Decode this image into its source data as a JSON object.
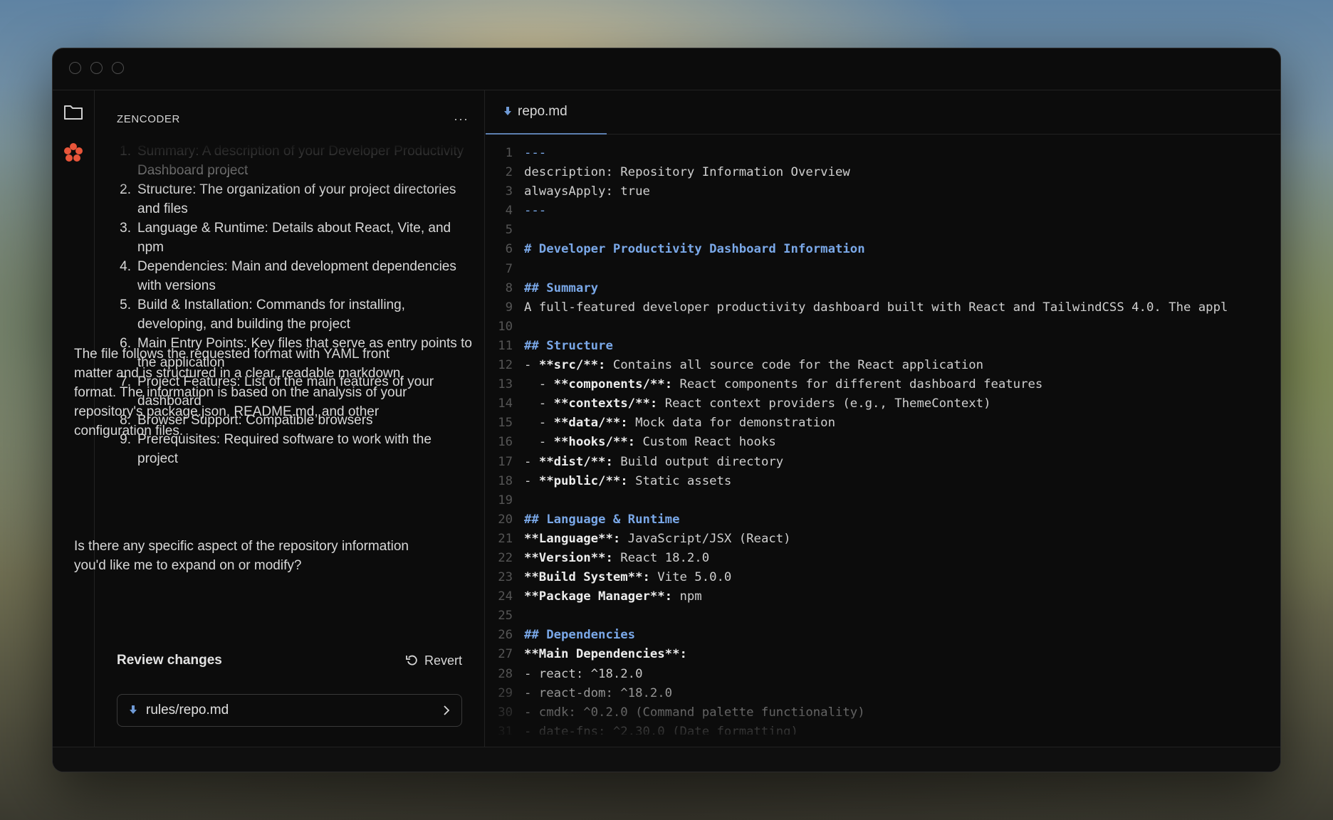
{
  "window": {
    "traffic_lights": [
      "close",
      "minimize",
      "zoom"
    ]
  },
  "activity_bar": {
    "icons": [
      "folder-icon",
      "zencoder-logo"
    ]
  },
  "chat": {
    "brand": "ZENCODER",
    "more_label": "···",
    "list": [
      {
        "num": "1.",
        "text": "Summary: A description of your Developer Productivity Dashboard project"
      },
      {
        "num": "2.",
        "text": "Structure: The organization of your project directories and files"
      },
      {
        "num": "3.",
        "text": "Language & Runtime: Details about React, Vite, and npm"
      },
      {
        "num": "4.",
        "text": "Dependencies: Main and development dependencies with versions"
      },
      {
        "num": "5.",
        "text": "Build & Installation: Commands for installing, developing, and building the project"
      },
      {
        "num": "6.",
        "text": "Main Entry Points: Key files that serve as entry points to the application"
      },
      {
        "num": "7.",
        "text": "Project Features: List of the main features of your dashboard"
      },
      {
        "num": "8.",
        "text": "Browser Support: Compatible browsers"
      },
      {
        "num": "9.",
        "text": "Prerequisites: Required software to work with the project"
      }
    ],
    "paragraph": "The file follows the requested format with YAML front matter and is structured in a clear, readable markdown format. The information is based on the analysis of your repository's package.json, README.md, and other configuration files.",
    "question": "Is there any specific aspect of the repository information you'd like me to expand on or modify?",
    "review_title": "Review changes",
    "revert_label": "Revert",
    "changed_file": "rules/repo.md"
  },
  "editor": {
    "tab_label": "repo.md",
    "lines": [
      [
        {
          "t": "---",
          "c": "sep"
        }
      ],
      [
        {
          "t": "description: Repository Information Overview",
          "c": ""
        }
      ],
      [
        {
          "t": "alwaysApply: true",
          "c": ""
        }
      ],
      [
        {
          "t": "---",
          "c": "sep"
        }
      ],
      [],
      [
        {
          "t": "# Developer Productivity Dashboard Information",
          "c": "hl"
        }
      ],
      [],
      [
        {
          "t": "## Summary",
          "c": "hl"
        }
      ],
      [
        {
          "t": "A full-featured developer productivity dashboard built with React and TailwindCSS 4.0. The appl",
          "c": ""
        }
      ],
      [],
      [
        {
          "t": "## Structure",
          "c": "hl"
        }
      ],
      [
        {
          "t": "- ",
          "c": ""
        },
        {
          "t": "**src/**:",
          "c": "b"
        },
        {
          "t": " Contains all source code for the React application",
          "c": ""
        }
      ],
      [
        {
          "t": "  - ",
          "c": ""
        },
        {
          "t": "**components/**:",
          "c": "b"
        },
        {
          "t": " React components for different dashboard features",
          "c": ""
        }
      ],
      [
        {
          "t": "  - ",
          "c": ""
        },
        {
          "t": "**contexts/**:",
          "c": "b"
        },
        {
          "t": " React context providers (e.g., ThemeContext)",
          "c": ""
        }
      ],
      [
        {
          "t": "  - ",
          "c": ""
        },
        {
          "t": "**data/**:",
          "c": "b"
        },
        {
          "t": " Mock data for demonstration",
          "c": ""
        }
      ],
      [
        {
          "t": "  - ",
          "c": ""
        },
        {
          "t": "**hooks/**:",
          "c": "b"
        },
        {
          "t": " Custom React hooks",
          "c": ""
        }
      ],
      [
        {
          "t": "- ",
          "c": ""
        },
        {
          "t": "**dist/**:",
          "c": "b"
        },
        {
          "t": " Build output directory",
          "c": ""
        }
      ],
      [
        {
          "t": "- ",
          "c": ""
        },
        {
          "t": "**public/**:",
          "c": "b"
        },
        {
          "t": " Static assets",
          "c": ""
        }
      ],
      [],
      [
        {
          "t": "## Language & Runtime",
          "c": "hl"
        }
      ],
      [
        {
          "t": "**Language**:",
          "c": "b"
        },
        {
          "t": " JavaScript/JSX (React)",
          "c": ""
        }
      ],
      [
        {
          "t": "**Version**:",
          "c": "b"
        },
        {
          "t": " React 18.2.0",
          "c": ""
        }
      ],
      [
        {
          "t": "**Build System**:",
          "c": "b"
        },
        {
          "t": " Vite 5.0.0",
          "c": ""
        }
      ],
      [
        {
          "t": "**Package Manager**:",
          "c": "b"
        },
        {
          "t": " npm",
          "c": ""
        }
      ],
      [],
      [
        {
          "t": "## Dependencies",
          "c": "hl"
        }
      ],
      [
        {
          "t": "**Main Dependencies**:",
          "c": "b"
        }
      ],
      [
        {
          "t": "- react: ^18.2.0",
          "c": ""
        }
      ],
      [
        {
          "t": "- react-dom: ^18.2.0",
          "c": ""
        }
      ],
      [
        {
          "t": "- cmdk: ^0.2.0 (Command palette functionality)",
          "c": ""
        }
      ],
      [
        {
          "t": "- date-fns: ^2.30.0 (Date formatting)",
          "c": ""
        }
      ]
    ]
  }
}
